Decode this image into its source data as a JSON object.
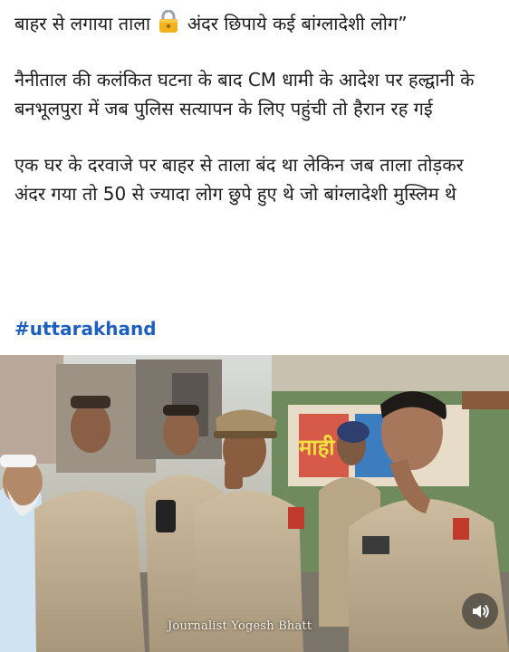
{
  "post": {
    "headline_part1": "बाहर से लगाया ताला",
    "headline_icon": "lock-icon",
    "headline_part2": "अंदर छिपाये कई बांग्लादेशी लोग”",
    "paragraph1": "नैनीताल की कलंकित घटना के बाद CM  धामी के आदेश पर हल्द्वानी के बनभूलपुरा में जब पुलिस सत्यापन के लिए पहुंची तो हैरान रह गई",
    "paragraph2": "एक घर के दरवाजे पर बाहर से ताला बंद था लेकिन जब ताला तोड़कर अंदर गया तो 50 से ज्यादा लोग छुपे हुए थे जो बांग्लादेशी मुस्लिम थे",
    "hashtag": "#uttarakhand"
  },
  "video": {
    "watermark": "Journalist Yogesh Bhatt",
    "volume_icon": "speaker-volume-icon",
    "truck_sign": "माही सं"
  },
  "colors": {
    "hashtag": "#1f5fbf",
    "text": "#1c1c1c",
    "uniform": "#c8b79a"
  }
}
